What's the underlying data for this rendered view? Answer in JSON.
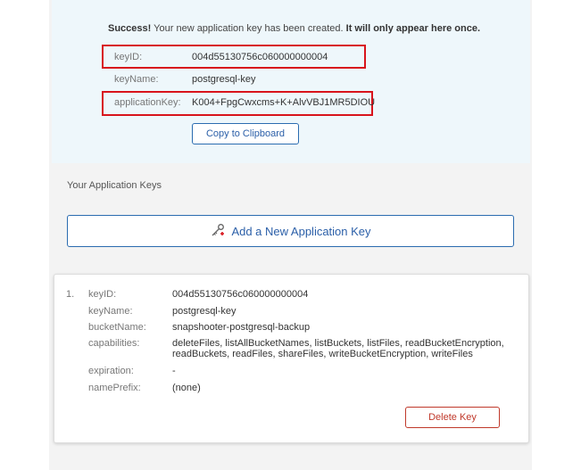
{
  "success": {
    "prefix": "Success!",
    "message": "Your new application key has been created.",
    "emphasis": "It will only appear here once.",
    "rows": [
      {
        "label": "keyID:",
        "value": "004d55130756c060000000004"
      },
      {
        "label": "keyName:",
        "value": "postgresql-key"
      },
      {
        "label": "applicationKey:",
        "value": "K004+FpgCwxcms+K+AlvVBJ1MR5DIOU"
      }
    ],
    "copy_label": "Copy to Clipboard"
  },
  "keys_section": {
    "title": "Your Application Keys",
    "add_label": "Add a New Application Key",
    "add_icon": "key-add-icon"
  },
  "key_card": {
    "number": "1.",
    "rows": [
      {
        "label": "keyID:",
        "value": "004d55130756c060000000004"
      },
      {
        "label": "keyName:",
        "value": "postgresql-key"
      },
      {
        "label": "bucketName:",
        "value": "snapshooter-postgresql-backup"
      },
      {
        "label": "capabilities:",
        "value_line1": "deleteFiles, listAllBucketNames, listBuckets, listFiles, readBucketEncryption,",
        "value_line2": "readBuckets, readFiles, shareFiles, writeBucketEncryption, writeFiles"
      },
      {
        "label": "expiration:",
        "value": "-"
      },
      {
        "label": "namePrefix:",
        "value": "(none)"
      }
    ],
    "delete_label": "Delete Key"
  },
  "colors": {
    "accent": "#2b6cb0",
    "highlight": "#d8141c",
    "danger": "#c0392b",
    "success_bg": "#eef7fb"
  }
}
